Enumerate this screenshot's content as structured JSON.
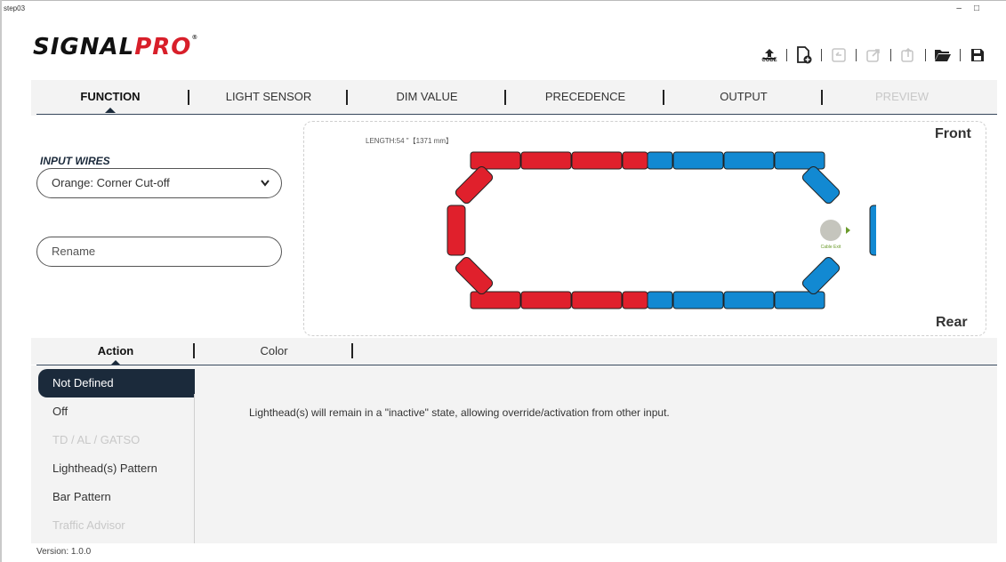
{
  "window": {
    "title": "step03",
    "controls": [
      "–",
      "□"
    ]
  },
  "logo": {
    "part1": "SIGNAL",
    "part2": "PRO",
    "reg": "®"
  },
  "toolbar": {
    "items": [
      {
        "icon": "upload-code-icon",
        "label": "CODE",
        "enabled": true
      },
      {
        "icon": "new-file-icon",
        "enabled": true
      },
      {
        "icon": "undo-icon",
        "enabled": false
      },
      {
        "icon": "export-icon",
        "enabled": false
      },
      {
        "icon": "share-icon",
        "enabled": false
      },
      {
        "icon": "open-folder-icon",
        "enabled": true
      },
      {
        "icon": "save-icon",
        "enabled": true
      }
    ]
  },
  "main_tabs": [
    {
      "label": "FUNCTION",
      "active": true
    },
    {
      "label": "LIGHT SENSOR"
    },
    {
      "label": "DIM VALUE"
    },
    {
      "label": "PRECEDENCE"
    },
    {
      "label": "OUTPUT"
    },
    {
      "label": "PREVIEW",
      "disabled": true
    }
  ],
  "input_wires": {
    "label": "INPUT WIRES",
    "selected": "Orange:  Corner Cut-off",
    "rename_placeholder": "Rename"
  },
  "preview": {
    "length_label": "LENGTH:54 \"【1371 mm】",
    "front": "Front",
    "rear": "Rear",
    "cable_exit": "Cable Exit",
    "colors": {
      "red": "#e0202c",
      "blue": "#1289d2"
    }
  },
  "sub_tabs": [
    {
      "label": "Action",
      "active": true
    },
    {
      "label": "Color"
    }
  ],
  "actions": [
    {
      "label": "Not Defined",
      "active": true
    },
    {
      "label": "Off"
    },
    {
      "label": "TD / AL / GATSO",
      "disabled": true
    },
    {
      "label": "Lighthead(s) Pattern"
    },
    {
      "label": "Bar Pattern"
    },
    {
      "label": "Traffic Advisor",
      "disabled": true
    }
  ],
  "description": "Lighthead(s) will remain in a  \"inactive\" state, allowing override/activation from other input.",
  "version": "Version: 1.0.0"
}
